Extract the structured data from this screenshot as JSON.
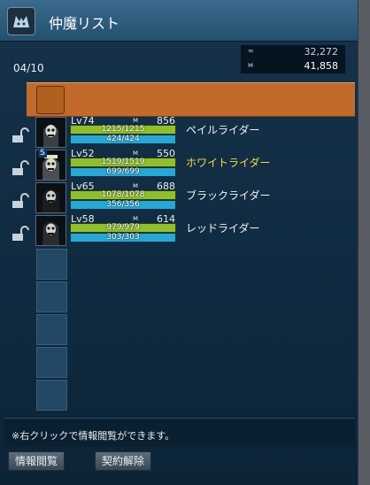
{
  "window": {
    "title": "仲魔リスト"
  },
  "currency": [
    {
      "icon": "coin-icon",
      "label": "32,272"
    },
    {
      "icon": "magnetite-icon",
      "label": "41,858"
    }
  ],
  "page_count": "04/10",
  "demons": [
    {
      "level": "Lv74",
      "mag": "856",
      "hp": "1215/1215",
      "mp": "424/424",
      "hp_ratio": 1.0,
      "mp_ratio": 1.0,
      "name": "ペイルライダー",
      "highlight": false,
      "badge": ""
    },
    {
      "level": "Lv52",
      "mag": "550",
      "hp": "1519/1519",
      "mp": "699/699",
      "hp_ratio": 1.0,
      "mp_ratio": 1.0,
      "name": "ホワイトライダー",
      "highlight": true,
      "badge": "S"
    },
    {
      "level": "Lv65",
      "mag": "688",
      "hp": "1078/1078",
      "mp": "356/356",
      "hp_ratio": 1.0,
      "mp_ratio": 1.0,
      "name": "ブラックライダー",
      "highlight": false,
      "badge": ""
    },
    {
      "level": "Lv58",
      "mag": "614",
      "hp": "979/979",
      "mp": "303/303",
      "hp_ratio": 1.0,
      "mp_ratio": 1.0,
      "name": "レッドライダー",
      "highlight": false,
      "badge": ""
    }
  ],
  "info_text": "※右クリックで情報閲覧ができます。",
  "buttons": {
    "info": "情報閲覧",
    "dismiss": "契約解除"
  },
  "colors": {
    "selected_row": "#c16a2c",
    "highlight_name": "#ffd84a",
    "hp_bar": "#8fbf2f",
    "mp_bar": "#29a7d4"
  }
}
